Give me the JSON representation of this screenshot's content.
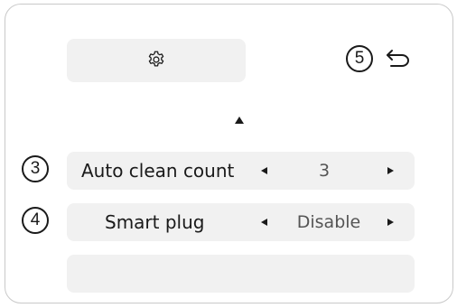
{
  "markers": {
    "back": "5",
    "auto_clean": "3",
    "smart_plug": "4"
  },
  "header": {
    "settings_icon": "gear-icon",
    "back_icon": "back-arrow-icon"
  },
  "rows": [
    {
      "label": "Auto clean count",
      "value": "3"
    },
    {
      "label": "Smart plug",
      "value": "Disable"
    }
  ],
  "colors": {
    "row_background": "#f1f1f1",
    "panel_border": "#c9c9c9",
    "value_text": "#555555"
  }
}
